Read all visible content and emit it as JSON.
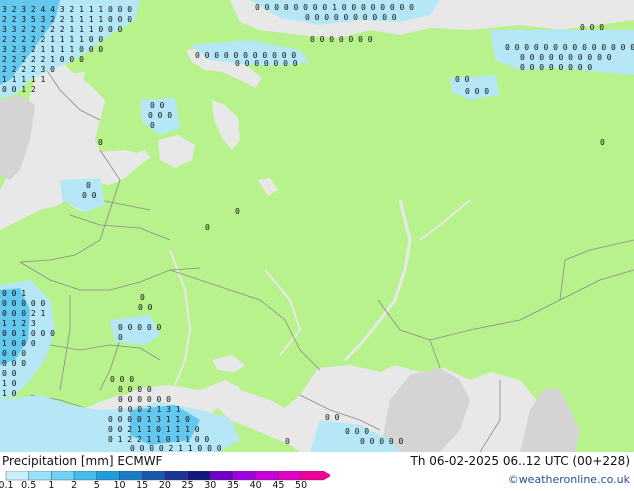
{
  "map": {
    "region": "Eastern Europe and western Russia",
    "colors": {
      "land_precip_free": "#b8f28c",
      "water": "#e8e8e8",
      "unmodelled_land": "#d4d4d4",
      "border": "#8a8a8a",
      "light_precip": "#b6e7f6",
      "medium_precip": "#64c8ee"
    }
  },
  "footer": {
    "title": "Precipitation [mm] ECMWF",
    "valid_time": "Th 06-02-2025 06..12 UTC (00+228)",
    "credit": "©weatheronline.co.uk",
    "scale": {
      "labels": [
        "0.1",
        "0.5",
        "1",
        "2",
        "5",
        "10",
        "15",
        "20",
        "25",
        "30",
        "35",
        "40",
        "45",
        "50"
      ],
      "colors": [
        "#c8f0ff",
        "#9ae2fa",
        "#70d2f2",
        "#45bbe8",
        "#1e9edb",
        "#1a7cc8",
        "#1a58b0",
        "#1a3596",
        "#121880",
        "#6e00c8",
        "#a000e0",
        "#c800d8",
        "#e000c8",
        "#f00098"
      ]
    }
  }
}
